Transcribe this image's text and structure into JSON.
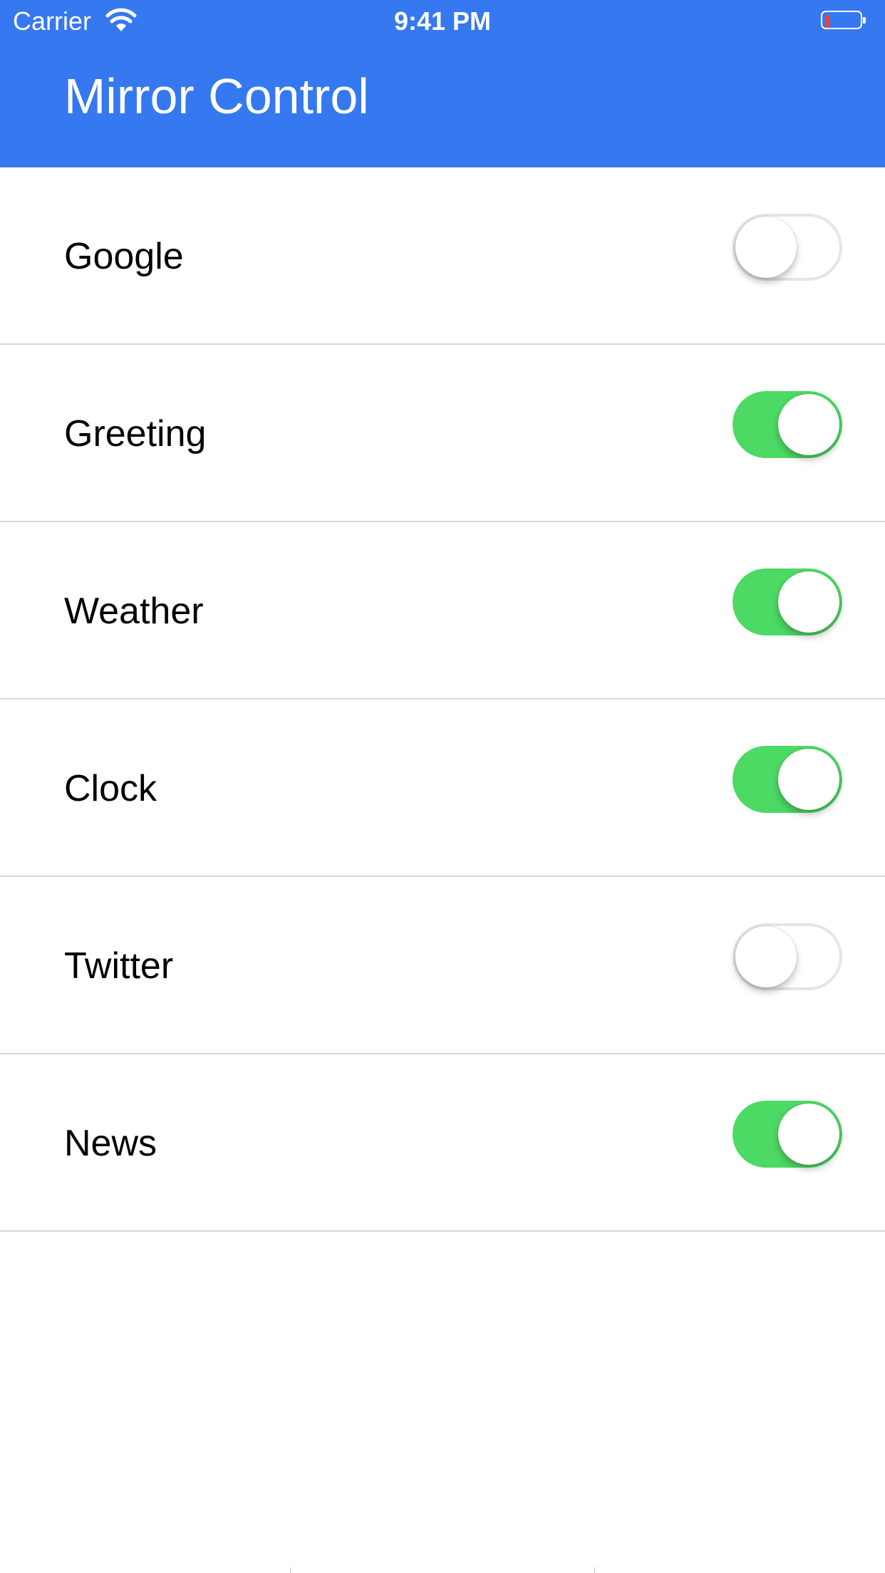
{
  "status_bar": {
    "carrier": "Carrier",
    "time": "9:41 PM",
    "wifi_icon": "wifi-icon",
    "battery_icon": "battery-icon",
    "battery_level": 0.12,
    "battery_color": "#ff3b30"
  },
  "header": {
    "title": "Mirror Control",
    "background": "#3578f0"
  },
  "settings": [
    {
      "label": "Google",
      "enabled": false
    },
    {
      "label": "Greeting",
      "enabled": true
    },
    {
      "label": "Weather",
      "enabled": true
    },
    {
      "label": "Clock",
      "enabled": true
    },
    {
      "label": "Twitter",
      "enabled": false
    },
    {
      "label": "News",
      "enabled": true
    }
  ],
  "colors": {
    "switch_on": "#4cd964",
    "switch_off_border": "#e5e5e5",
    "separator": "#d6d6d6"
  }
}
